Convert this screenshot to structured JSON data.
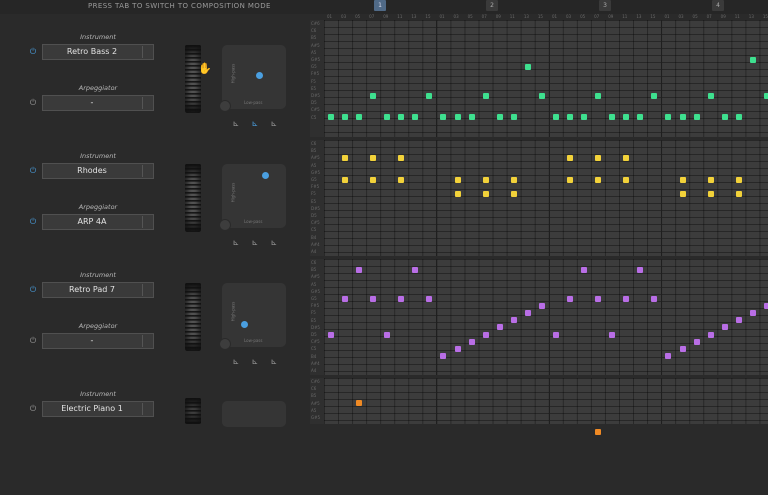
{
  "header": {
    "hint": "PRESS TAB TO SWITCH TO COMPOSITION MODE"
  },
  "ruler": {
    "bars": [
      "1",
      "2",
      "3",
      "4"
    ],
    "active_bar": 0,
    "ticks": [
      "01",
      "03",
      "05",
      "07",
      "09",
      "11",
      "13",
      "15",
      "01",
      "03",
      "05",
      "07",
      "09",
      "11",
      "13",
      "15",
      "01",
      "03",
      "05",
      "07",
      "09",
      "11",
      "13",
      "15",
      "01",
      "03",
      "05",
      "07",
      "09",
      "11",
      "13",
      "15"
    ]
  },
  "colors": {
    "accent": "#4a9fe0",
    "green": "#3ee08f",
    "yellow": "#f2d23a",
    "purple": "#b96ee6",
    "orange": "#f08a24"
  },
  "tracks": [
    {
      "instrument_label": "Instrument",
      "instrument": "Retro Bass 2",
      "arp_label": "Arpeggiator",
      "arp": "-",
      "instrument_power_on": true,
      "arp_power_on": false,
      "pad_x": 0.58,
      "pad_y": 0.48,
      "active_filter": 1,
      "pad_axis_y": "High-pass",
      "pad_axis_x": "Low-pass",
      "note_labels": [
        "C#6",
        "C6",
        "B5",
        "A#5",
        "A5",
        "G#5",
        "G5",
        "F#5",
        "F5",
        "E5",
        "D#5",
        "D5",
        "C#5",
        "C5"
      ],
      "color": "green",
      "notes": [
        [
          0,
          13
        ],
        [
          1,
          13
        ],
        [
          2,
          13
        ],
        [
          3,
          10
        ],
        [
          4,
          13
        ],
        [
          5,
          13
        ],
        [
          6,
          13
        ],
        [
          7,
          10
        ],
        [
          8,
          13
        ],
        [
          9,
          13
        ],
        [
          10,
          13
        ],
        [
          11,
          10
        ],
        [
          12,
          13
        ],
        [
          13,
          13
        ],
        [
          14,
          6
        ],
        [
          15,
          10
        ],
        [
          16,
          13
        ],
        [
          17,
          13
        ],
        [
          18,
          13
        ],
        [
          19,
          10
        ],
        [
          20,
          13
        ],
        [
          21,
          13
        ],
        [
          22,
          13
        ],
        [
          23,
          10
        ],
        [
          24,
          13
        ],
        [
          25,
          13
        ],
        [
          26,
          13
        ],
        [
          27,
          10
        ],
        [
          28,
          13
        ],
        [
          29,
          13
        ],
        [
          30,
          5
        ],
        [
          31,
          10
        ]
      ]
    },
    {
      "instrument_label": "Instrument",
      "instrument": "Rhodes",
      "arp_label": "Arpeggiator",
      "arp": "ARP 4A",
      "instrument_power_on": true,
      "arp_power_on": true,
      "pad_x": 0.68,
      "pad_y": 0.18,
      "active_filter": -1,
      "pad_axis_y": "High-pass",
      "pad_axis_x": "Low-pass",
      "note_labels": [
        "C6",
        "B5",
        "A#5",
        "A5",
        "G#5",
        "G5",
        "F#5",
        "F5",
        "E5",
        "D#5",
        "D5",
        "C#5",
        "C5",
        "B4",
        "A#4",
        "A4"
      ],
      "color": "yellow",
      "notes": [
        [
          1,
          2
        ],
        [
          3,
          2
        ],
        [
          5,
          2
        ],
        [
          1,
          5
        ],
        [
          3,
          5
        ],
        [
          5,
          5
        ],
        [
          9,
          5
        ],
        [
          11,
          5
        ],
        [
          13,
          5
        ],
        [
          9,
          7
        ],
        [
          11,
          7
        ],
        [
          13,
          7
        ],
        [
          17,
          2
        ],
        [
          19,
          2
        ],
        [
          21,
          2
        ],
        [
          17,
          5
        ],
        [
          19,
          5
        ],
        [
          21,
          5
        ],
        [
          25,
          5
        ],
        [
          27,
          5
        ],
        [
          29,
          5
        ],
        [
          25,
          7
        ],
        [
          27,
          7
        ],
        [
          29,
          7
        ]
      ]
    },
    {
      "instrument_label": "Instrument",
      "instrument": "Retro Pad 7",
      "arp_label": "Arpeggiator",
      "arp": "-",
      "instrument_power_on": true,
      "arp_power_on": false,
      "pad_x": 0.35,
      "pad_y": 0.65,
      "active_filter": -1,
      "pad_axis_y": "High-pass",
      "pad_axis_x": "Low-pass",
      "note_labels": [
        "C6",
        "B5",
        "A#5",
        "A5",
        "G#5",
        "G5",
        "F#5",
        "F5",
        "E5",
        "D#5",
        "D5",
        "C#5",
        "C5",
        "B4",
        "A#4",
        "A4"
      ],
      "color": "purple",
      "notes": [
        [
          0,
          10
        ],
        [
          1,
          5
        ],
        [
          2,
          1
        ],
        [
          3,
          5
        ],
        [
          4,
          10
        ],
        [
          5,
          5
        ],
        [
          6,
          1
        ],
        [
          7,
          5
        ],
        [
          8,
          13
        ],
        [
          9,
          12
        ],
        [
          10,
          11
        ],
        [
          11,
          10
        ],
        [
          12,
          9
        ],
        [
          13,
          8
        ],
        [
          14,
          7
        ],
        [
          15,
          6
        ],
        [
          16,
          10
        ],
        [
          17,
          5
        ],
        [
          18,
          1
        ],
        [
          19,
          5
        ],
        [
          20,
          10
        ],
        [
          21,
          5
        ],
        [
          22,
          1
        ],
        [
          23,
          5
        ],
        [
          24,
          13
        ],
        [
          25,
          12
        ],
        [
          26,
          11
        ],
        [
          27,
          10
        ],
        [
          28,
          9
        ],
        [
          29,
          8
        ],
        [
          30,
          7
        ],
        [
          31,
          6
        ]
      ]
    },
    {
      "instrument_label": "Instrument",
      "instrument": "Electric Piano 1",
      "arp_label": "",
      "arp": "",
      "instrument_power_on": false,
      "arp_power_on": false,
      "pad_x": 0.5,
      "pad_y": 0.5,
      "active_filter": -1,
      "pad_axis_y": "",
      "pad_axis_x": "",
      "note_labels": [
        "C#6",
        "C6",
        "B5",
        "A#5",
        "A5",
        "G#5"
      ],
      "color": "orange",
      "notes": [
        [
          2,
          3
        ],
        [
          19,
          7
        ]
      ]
    }
  ]
}
